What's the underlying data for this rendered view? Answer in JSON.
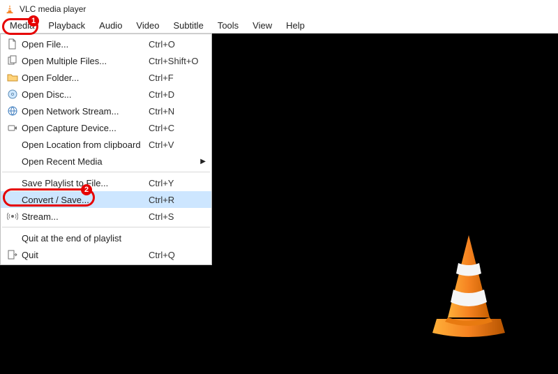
{
  "title": "VLC media player",
  "menubar": [
    "Media",
    "Playback",
    "Audio",
    "Video",
    "Subtitle",
    "Tools",
    "View",
    "Help"
  ],
  "media_menu": {
    "groups": [
      [
        {
          "icon": "file",
          "label": "Open File...",
          "shortcut": "Ctrl+O"
        },
        {
          "icon": "files",
          "label": "Open Multiple Files...",
          "shortcut": "Ctrl+Shift+O"
        },
        {
          "icon": "folder",
          "label": "Open Folder...",
          "shortcut": "Ctrl+F"
        },
        {
          "icon": "disc",
          "label": "Open Disc...",
          "shortcut": "Ctrl+D"
        },
        {
          "icon": "network",
          "label": "Open Network Stream...",
          "shortcut": "Ctrl+N"
        },
        {
          "icon": "capture",
          "label": "Open Capture Device...",
          "shortcut": "Ctrl+C"
        },
        {
          "icon": "",
          "label": "Open Location from clipboard",
          "shortcut": "Ctrl+V"
        },
        {
          "icon": "",
          "label": "Open Recent Media",
          "shortcut": "",
          "submenu": true
        }
      ],
      [
        {
          "icon": "",
          "label": "Save Playlist to File...",
          "shortcut": "Ctrl+Y"
        },
        {
          "icon": "",
          "label": "Convert / Save...",
          "shortcut": "Ctrl+R",
          "highlight": true
        },
        {
          "icon": "stream",
          "label": "Stream...",
          "shortcut": "Ctrl+S"
        }
      ],
      [
        {
          "icon": "",
          "label": "Quit at the end of playlist",
          "shortcut": ""
        },
        {
          "icon": "quit",
          "label": "Quit",
          "shortcut": "Ctrl+Q"
        }
      ]
    ]
  },
  "annotations": {
    "badge1": "1",
    "badge2": "2"
  }
}
